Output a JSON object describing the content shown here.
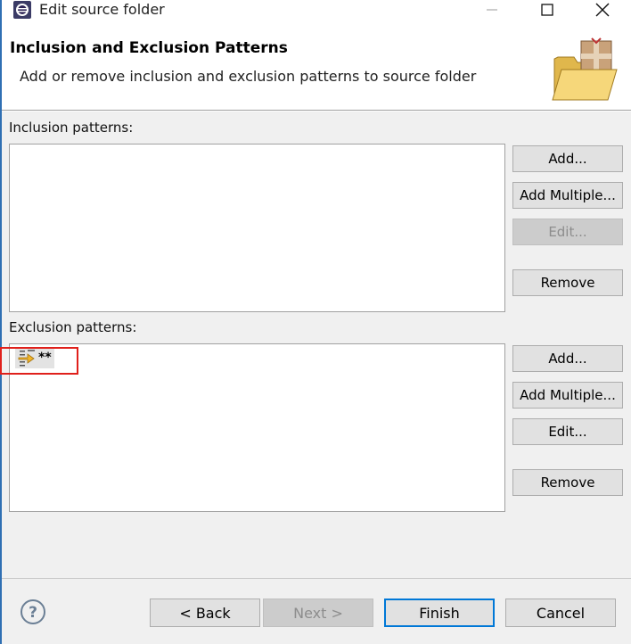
{
  "window": {
    "title": "Edit source folder",
    "controls": [
      "minimize-icon",
      "maximize-icon",
      "close-icon"
    ]
  },
  "header": {
    "title": "Inclusion and Exclusion Patterns",
    "description": "Add or remove inclusion and exclusion patterns to source folder",
    "icon": "folder-package-icon"
  },
  "inclusion": {
    "label": "Inclusion patterns:",
    "items": [],
    "buttons": {
      "add": "Add...",
      "add_multiple": "Add Multiple...",
      "edit": "Edit...",
      "remove": "Remove"
    }
  },
  "exclusion": {
    "label": "Exclusion patterns:",
    "items": [
      {
        "text": "**",
        "icon": "exclusion-pattern-icon"
      }
    ],
    "buttons": {
      "add": "Add...",
      "add_multiple": "Add Multiple...",
      "edit": "Edit...",
      "remove": "Remove"
    }
  },
  "footer": {
    "help_icon": "help-icon",
    "back": "< Back",
    "next": "Next >",
    "finish": "Finish",
    "cancel": "Cancel"
  },
  "colors": {
    "accent": "#0078d7",
    "highlight": "#e0201b",
    "dialog_bg": "#f0f0f0"
  }
}
